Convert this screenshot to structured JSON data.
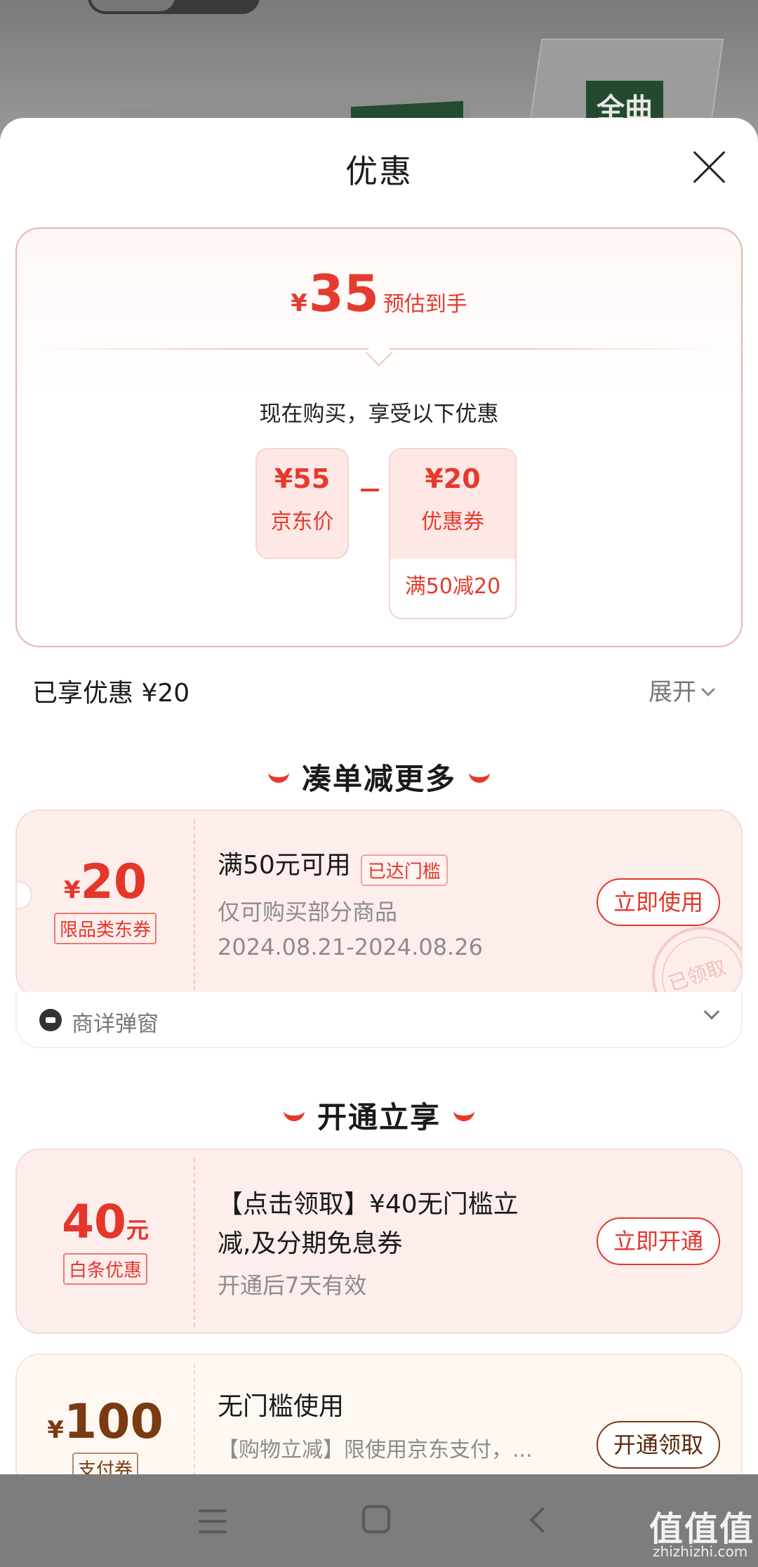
{
  "background": {
    "logo_text": "全曲"
  },
  "sheet": {
    "title": "优惠"
  },
  "estimate": {
    "currency": "¥",
    "price": "35",
    "label": "预估到手",
    "subtitle": "现在购买，享受以下优惠",
    "jd_price": {
      "value": "¥55",
      "label": "京东价"
    },
    "operator": "–",
    "coupon": {
      "value": "¥20",
      "label": "优惠券",
      "condition": "满50减20"
    }
  },
  "enjoyed": {
    "text": "已享优惠 ¥20",
    "expand_label": "展开"
  },
  "section1": {
    "title": "凑单减更多"
  },
  "coupon1": {
    "currency": "¥",
    "amount": "20",
    "tag": "限品类东券",
    "title": "满50元可用",
    "badge": "已达门槛",
    "desc": "仅可购买部分商品",
    "date": "2024.08.21-2024.08.26",
    "button": "立即使用",
    "stamp": "已领取",
    "footer": "商详弹窗"
  },
  "section2": {
    "title": "开通立享"
  },
  "coupon2": {
    "amount": "40",
    "unit": "元",
    "tag": "白条优惠",
    "title_line1": "【点击领取】¥40无门槛立",
    "title_line2": "减,及分期免息券",
    "desc": "开通后7天有效",
    "button": "立即开通"
  },
  "coupon3": {
    "currency": "¥",
    "amount": "100",
    "tag": "支付券",
    "title": "无门槛使用",
    "desc": "【购物立减】限使用京东支付，...",
    "button": "开通领取"
  },
  "watermark": {
    "main": "值值值",
    "sub": "zhizhizhi.com"
  },
  "colors": {
    "accent": "#e5362a",
    "brown": "#7a3a12"
  }
}
